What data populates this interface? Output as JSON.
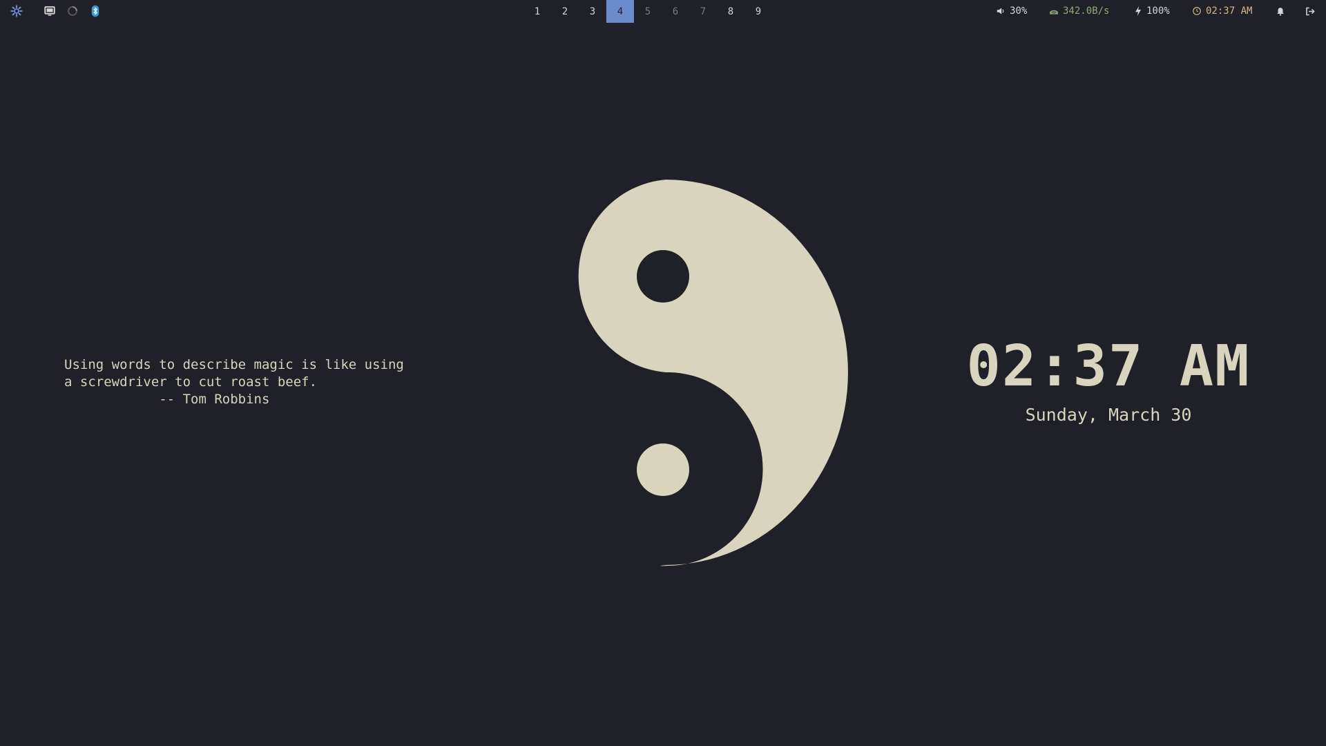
{
  "topbar": {
    "left_icons": [
      "settings-icon",
      "display-icon",
      "vpn-icon",
      "bluetooth-icon"
    ],
    "workspaces": [
      {
        "label": "1",
        "state": "occupied"
      },
      {
        "label": "2",
        "state": "occupied"
      },
      {
        "label": "3",
        "state": "occupied"
      },
      {
        "label": "4",
        "state": "active"
      },
      {
        "label": "5",
        "state": "empty"
      },
      {
        "label": "6",
        "state": "empty"
      },
      {
        "label": "7",
        "state": "empty"
      },
      {
        "label": "8",
        "state": "occupied"
      },
      {
        "label": "9",
        "state": "occupied"
      }
    ],
    "volume": "30%",
    "network": "342.0B/s",
    "battery": "100%",
    "clock": "02:37 AM",
    "colors": {
      "accent": "#6b8ccc",
      "network": "#8faa7a",
      "clock": "#d8b888",
      "bluetooth": "#3a9ad9"
    }
  },
  "quote": {
    "line1": "Using words to describe magic is like using",
    "line2": "a screwdriver to cut roast beef.",
    "author": "            -- Tom Robbins"
  },
  "desktop_clock": {
    "time": "02:37 AM",
    "date": "Sunday, March 30"
  },
  "colors": {
    "background": "#1f2028",
    "foreground": "#d8d4bd"
  }
}
